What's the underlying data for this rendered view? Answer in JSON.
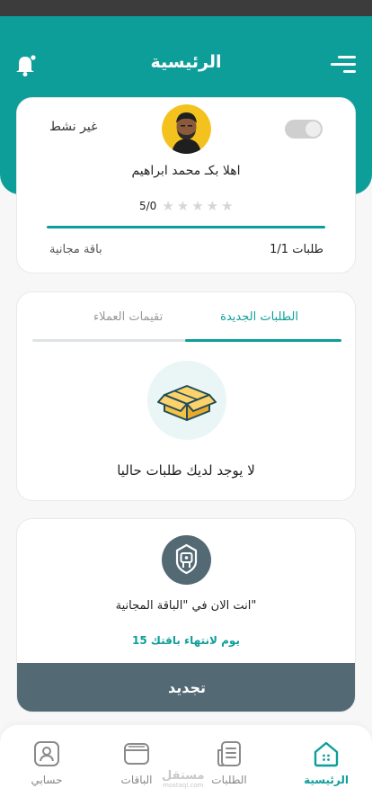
{
  "header": {
    "title": "الرئيسية"
  },
  "profile": {
    "status": "غير نشط",
    "greeting": "اهلا بكـ محمد ابراهيم",
    "rating_value": "5/0",
    "rating_stars": 0,
    "orders_progress": 1.0,
    "orders_count": "1/1 طلبات",
    "plan_name": "باقة مجانية"
  },
  "tabs": {
    "new_orders": "الطلبات الجديدة",
    "customer_reviews": "تقيمات العملاء",
    "empty_message": "لا يوجد لديك طلبات حاليا"
  },
  "plan": {
    "current_text": "انت الان في \"الباقة المجانية\"",
    "days_left": "15 يوم لانتهاء باقتك",
    "renew_label": "تجديد"
  },
  "bottom_nav": {
    "items": [
      {
        "label": "الرئيسية",
        "icon": "home-icon"
      },
      {
        "label": "الطلبات",
        "icon": "orders-icon"
      },
      {
        "label": "الباقات",
        "icon": "wallet-icon"
      },
      {
        "label": "حسابي",
        "icon": "profile-icon"
      }
    ],
    "watermark": "مستقل",
    "watermark_sub": "mostaql.com"
  },
  "colors": {
    "primary": "#0e9e9a",
    "dark": "#536974",
    "background": "#f7f7f7"
  }
}
